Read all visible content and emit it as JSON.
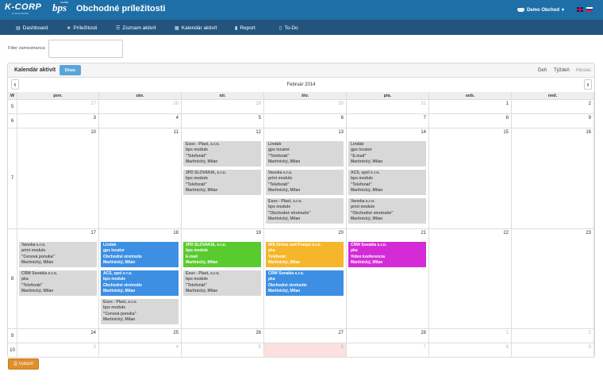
{
  "brand": {
    "logo": "K-CORP",
    "logo_sub": "IT SOLUTIONS",
    "product": "bps",
    "product_sup": "mobile"
  },
  "app_title": "Obchodné príležitosti",
  "user": {
    "name": "Demo Obchod"
  },
  "nav": [
    {
      "label": "Dashboard",
      "icon": "dashboard-icon",
      "glyph": "▤"
    },
    {
      "label": "Príležitosti",
      "icon": "star-icon",
      "glyph": "★"
    },
    {
      "label": "Zoznam aktivít",
      "icon": "list-icon",
      "glyph": "☰"
    },
    {
      "label": "Kalendár aktivít",
      "icon": "calendar-icon",
      "glyph": "▦"
    },
    {
      "label": "Report",
      "icon": "bar-chart-icon",
      "glyph": "▮"
    },
    {
      "label": "To-Do",
      "icon": "clipboard-icon",
      "glyph": "▯"
    }
  ],
  "filter": {
    "label": "Filter zamestnanca:",
    "value": ""
  },
  "calendar": {
    "title": "Kalendár aktivít",
    "today_label": "Dnes",
    "views": [
      "Deň",
      "Týždeň",
      "Mesiac"
    ],
    "active_view": "Mesiac",
    "month_title": "Február 2014",
    "prev": "‹",
    "next": "›",
    "week_col_header": "W",
    "weekdays": [
      "pon.",
      "uto.",
      "str.",
      "štv.",
      "pia.",
      "sob.",
      "ned."
    ],
    "weeks": [
      {
        "week": "5",
        "days": [
          {
            "d": "27",
            "other": true
          },
          {
            "d": "28",
            "other": true
          },
          {
            "d": "29",
            "other": true
          },
          {
            "d": "30",
            "other": true
          },
          {
            "d": "31",
            "other": true
          },
          {
            "d": "1",
            "other": false
          },
          {
            "d": "2",
            "other": false
          }
        ]
      },
      {
        "week": "6",
        "days": [
          {
            "d": "3",
            "other": false
          },
          {
            "d": "4",
            "other": false
          },
          {
            "d": "5",
            "other": false
          },
          {
            "d": "6",
            "other": false
          },
          {
            "d": "7",
            "other": false
          },
          {
            "d": "8",
            "other": false
          },
          {
            "d": "9",
            "other": false
          }
        ]
      },
      {
        "week": "7",
        "days": [
          {
            "d": "10",
            "other": false
          },
          {
            "d": "11",
            "other": false
          },
          {
            "d": "12",
            "other": false
          },
          {
            "d": "13",
            "other": false
          },
          {
            "d": "14",
            "other": false
          },
          {
            "d": "15",
            "other": false
          },
          {
            "d": "16",
            "other": false
          }
        ]
      },
      {
        "week": "8",
        "days": [
          {
            "d": "17",
            "other": false
          },
          {
            "d": "18",
            "other": false
          },
          {
            "d": "19",
            "other": false
          },
          {
            "d": "20",
            "other": false
          },
          {
            "d": "21",
            "other": false
          },
          {
            "d": "22",
            "other": false
          },
          {
            "d": "23",
            "other": false
          }
        ]
      },
      {
        "week": "9",
        "days": [
          {
            "d": "24",
            "other": false
          },
          {
            "d": "25",
            "other": false
          },
          {
            "d": "26",
            "other": false
          },
          {
            "d": "27",
            "other": false
          },
          {
            "d": "28",
            "other": false
          },
          {
            "d": "1",
            "other": true
          },
          {
            "d": "2",
            "other": true
          }
        ]
      },
      {
        "week": "10",
        "days": [
          {
            "d": "3",
            "other": true
          },
          {
            "d": "4",
            "other": true
          },
          {
            "d": "5",
            "other": true
          },
          {
            "d": "6",
            "other": true,
            "today": true
          },
          {
            "d": "7",
            "other": true
          },
          {
            "d": "8",
            "other": true
          },
          {
            "d": "9",
            "other": true
          }
        ]
      }
    ],
    "events": [
      {
        "week": 2,
        "day": 2,
        "slot": 0,
        "color": "gray",
        "lines": [
          "Esox - Plast, s.r.o.",
          "bps module",
          "\"Telefonát\"",
          "Martinický, Milan"
        ]
      },
      {
        "week": 2,
        "day": 2,
        "slot": 1,
        "color": "gray",
        "lines": [
          "3PD SLOVAKIA, s.r.o.",
          "bps module",
          "\"Telefonát\"",
          "Martinický, Milan"
        ]
      },
      {
        "week": 2,
        "day": 3,
        "slot": 0,
        "color": "gray",
        "lines": [
          "Lindab",
          "gps locator",
          "\"Telefonát\"",
          "Martinický, Milan"
        ]
      },
      {
        "week": 2,
        "day": 3,
        "slot": 1,
        "color": "gray",
        "lines": [
          "Vanoka s.r.o.",
          "print module",
          "\"Telefonát\"",
          "Martinický, Milan"
        ]
      },
      {
        "week": 2,
        "day": 3,
        "slot": 2,
        "color": "gray",
        "lines": [
          "Esox - Plast, s.r.o.",
          "bps module",
          "\"Obchodné stretnutie\"",
          "Martinický, Milan"
        ]
      },
      {
        "week": 2,
        "day": 4,
        "slot": 0,
        "color": "gray",
        "lines": [
          "Lindab",
          "gps locator",
          "\"E-mail\"",
          "Martinický, Milan"
        ]
      },
      {
        "week": 2,
        "day": 4,
        "slot": 1,
        "color": "gray",
        "lines": [
          "ACS, spol s r.o.",
          "bps module",
          "\"Telefonát\"",
          "Martinický, Milan"
        ]
      },
      {
        "week": 2,
        "day": 4,
        "slot": 2,
        "color": "gray",
        "lines": [
          "Vanoka s.r.o.",
          "print module",
          "\"Obchodné stretnutie\"",
          "Martinický, Milan"
        ]
      },
      {
        "week": 3,
        "day": 0,
        "slot": 0,
        "color": "gray",
        "lines": [
          "Vanoka s.r.o.",
          "print module",
          "\"Cenová ponuka\"",
          "Martinický, Milan"
        ]
      },
      {
        "week": 3,
        "day": 0,
        "slot": 1,
        "color": "gray",
        "lines": [
          "CRW Sovakia s.r.o.",
          "pka",
          "\"Telefonát\"",
          "Martinický, Milan"
        ]
      },
      {
        "week": 3,
        "day": 1,
        "slot": 0,
        "color": "blue",
        "lines": [
          "Lindab",
          "gps locator",
          "Obchodné stretnutie",
          "Martinický, Milan"
        ]
      },
      {
        "week": 3,
        "day": 1,
        "slot": 1,
        "color": "blue",
        "lines": [
          "ACS, spol s r.o.",
          "bps module",
          "Obchodné stretnutie",
          "Martinický, Milan"
        ]
      },
      {
        "week": 3,
        "day": 1,
        "slot": 2,
        "color": "gray",
        "lines": [
          "Esox - Plast, s.r.o.",
          "bps module",
          "\"Cenová ponuka\"",
          "Martinický, Milan"
        ]
      },
      {
        "week": 3,
        "day": 2,
        "slot": 0,
        "color": "green",
        "lines": [
          "3PD SLOVAKIA, s.r.o.",
          "bps module",
          "E-mail",
          "Martinický, Milan"
        ]
      },
      {
        "week": 3,
        "day": 2,
        "slot": 1,
        "color": "gray",
        "lines": [
          "Esox - Plast, s.r.o.",
          "bps module",
          "\"Telefonát\"",
          "Martinický, Milan"
        ]
      },
      {
        "week": 3,
        "day": 3,
        "slot": 0,
        "color": "orange",
        "lines": [
          "IMS Drives and Pumps s.r.o.",
          "pka",
          "Telefonát",
          "Martinický, Milan"
        ]
      },
      {
        "week": 3,
        "day": 3,
        "slot": 1,
        "color": "blue",
        "lines": [
          "CRW Sovakia s.r.o.",
          "pka",
          "Obchodné stretnutie",
          "Martinický, Milan"
        ]
      },
      {
        "week": 3,
        "day": 4,
        "slot": 0,
        "color": "magenta",
        "lines": [
          "CRW Sovakia s.r.o.",
          "pka",
          "Video konferencia",
          "Martinický, Milan"
        ]
      }
    ]
  },
  "print_button": {
    "label": "Vytlačiť"
  }
}
